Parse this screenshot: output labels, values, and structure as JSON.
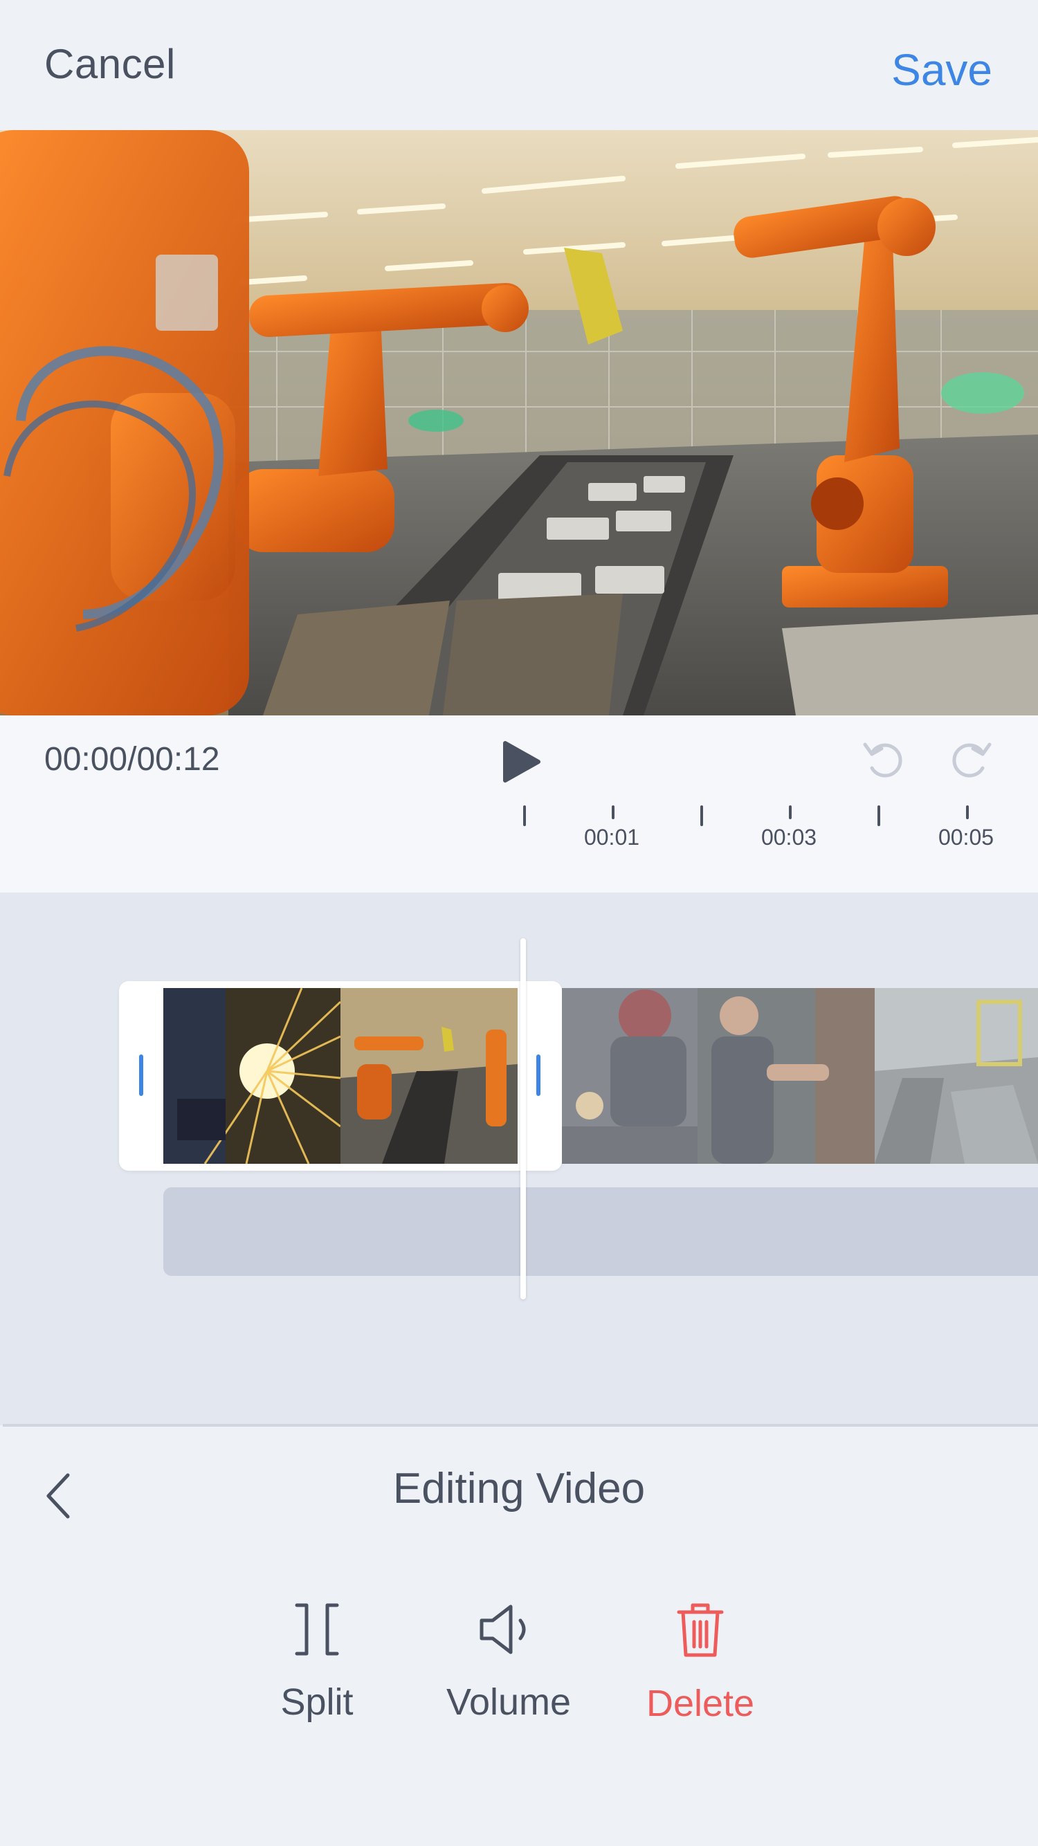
{
  "header": {
    "cancel_label": "Cancel",
    "save_label": "Save",
    "accent_color": "#3d86e6"
  },
  "preview": {
    "icon": "video-preview-frame"
  },
  "playback": {
    "timecode": "00:00/00:12",
    "play_icon": "play-icon",
    "undo_icon": "undo-icon",
    "redo_icon": "redo-icon",
    "ruler_labels": [
      "00:01",
      "00:03",
      "00:05"
    ]
  },
  "timeline": {
    "playhead_color": "#ffffff",
    "selection_handle_color": "#3d86e6"
  },
  "panel": {
    "back_icon": "chevron-left-icon",
    "title": "Editing Video",
    "tools": [
      {
        "label": "Split",
        "icon": "split-icon"
      },
      {
        "label": "Volume",
        "icon": "volume-icon"
      },
      {
        "label": "Delete",
        "icon": "trash-icon",
        "color": "#ee5b5b"
      }
    ]
  }
}
